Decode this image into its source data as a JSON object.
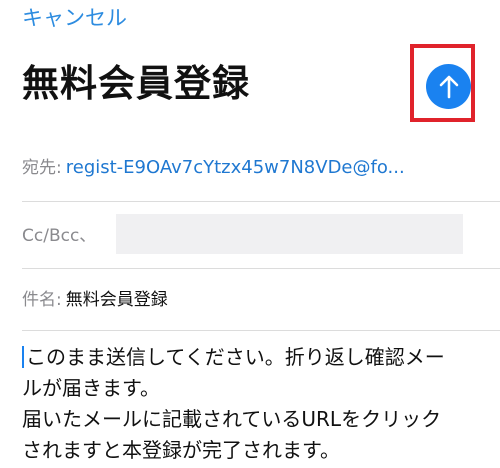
{
  "header": {
    "cancel_label": "キャンセル",
    "title": "無料会員登録",
    "send_icon": "arrow-up-icon"
  },
  "fields": {
    "to_label": "宛先:",
    "to_value": "regist-E9OAv7cYtzx45w7N8VDe@fo...",
    "cc_label": "Cc/Bcc、",
    "subject_label": "件名:",
    "subject_value": "無料会員登録"
  },
  "body": {
    "line_1": "このまま送信してください。折り返し確認メー",
    "line_2": "ルが届きます。",
    "line_3": "届いたメールに記載されているURLをクリック",
    "line_4": "されますと本登録が完了されます。"
  },
  "colors": {
    "accent": "#1a82f0",
    "link": "#2d8ce0",
    "highlight_box": "#e0232b"
  }
}
